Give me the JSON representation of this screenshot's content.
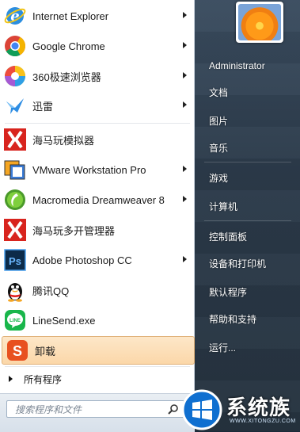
{
  "programs": [
    {
      "label": "Internet Explorer",
      "icon": "internet-explorer-icon",
      "submenu": true
    },
    {
      "label": "Google Chrome",
      "icon": "chrome-icon",
      "submenu": true
    },
    {
      "label": "360极速浏览器",
      "icon": "360-browser-icon",
      "submenu": true
    },
    {
      "label": "迅雷",
      "icon": "xunlei-icon",
      "submenu": true
    },
    {
      "label": "海马玩模拟器",
      "icon": "haima-emulator-icon",
      "submenu": false
    },
    {
      "label": "VMware Workstation Pro",
      "icon": "vmware-icon",
      "submenu": true
    },
    {
      "label": "Macromedia Dreamweaver 8",
      "icon": "dreamweaver-icon",
      "submenu": true
    },
    {
      "label": "海马玩多开管理器",
      "icon": "haima-multi-icon",
      "submenu": false
    },
    {
      "label": "Adobe Photoshop CC",
      "icon": "photoshop-icon",
      "submenu": true
    },
    {
      "label": "腾讯QQ",
      "icon": "qq-icon",
      "submenu": false
    },
    {
      "label": "LineSend.exe",
      "icon": "line-icon",
      "submenu": false
    },
    {
      "label": "卸载",
      "icon": "uninstall-icon",
      "submenu": false,
      "selected": true
    }
  ],
  "all_programs": "所有程序",
  "search": {
    "placeholder": "搜索程序和文件"
  },
  "right_items": [
    "Administrator",
    "文档",
    "图片",
    "音乐",
    "游戏",
    "计算机",
    "控制面板",
    "设备和打印机",
    "默认程序",
    "帮助和支持",
    "运行..."
  ],
  "watermark": {
    "title": "系统族",
    "url": "WWW.XITONGZU.COM"
  },
  "colors": {
    "selected_bg": "#fbd7a9",
    "right_panel": "#2c3b4b"
  }
}
